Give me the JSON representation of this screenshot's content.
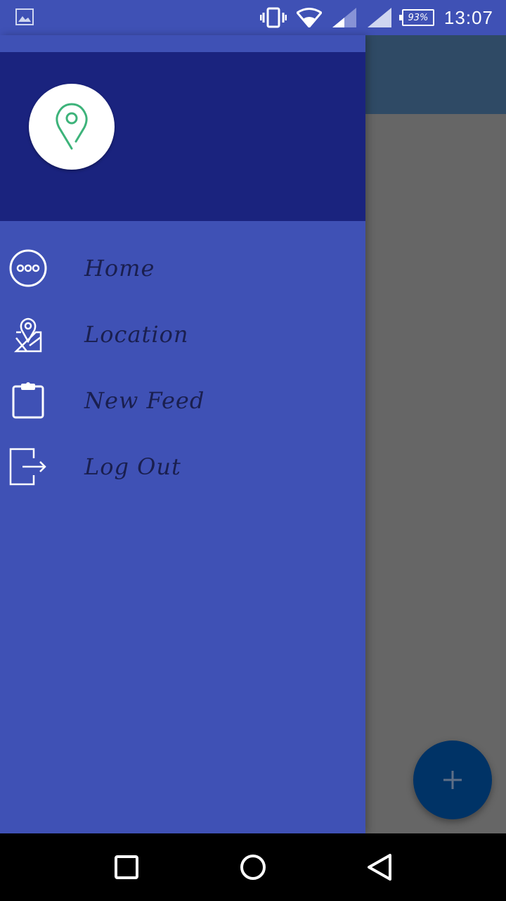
{
  "status_bar": {
    "battery_percent": "93%",
    "time": "13:07",
    "icons": [
      "gallery-icon",
      "vibrate-icon",
      "wifi-icon",
      "signal-icon",
      "signal-full-icon",
      "battery-icon"
    ]
  },
  "drawer": {
    "header": {
      "avatar_icon": "location-pin-icon"
    },
    "menu": [
      {
        "label": "Home",
        "icon": "more-horiz-circle-icon"
      },
      {
        "label": "Location",
        "icon": "map-location-icon"
      },
      {
        "label": "New Feed",
        "icon": "clipboard-icon"
      },
      {
        "label": "Log Out",
        "icon": "logout-icon"
      }
    ]
  },
  "fab": {
    "icon": "plus-icon"
  },
  "nav_bar": {
    "buttons": [
      "recents-icon",
      "home-circle-icon",
      "back-triangle-icon"
    ]
  },
  "colors": {
    "primary": "#3f51b5",
    "header": "#1a237e",
    "accent_pin": "#3db37a",
    "fab": "#003366",
    "scrim": "#666666"
  }
}
